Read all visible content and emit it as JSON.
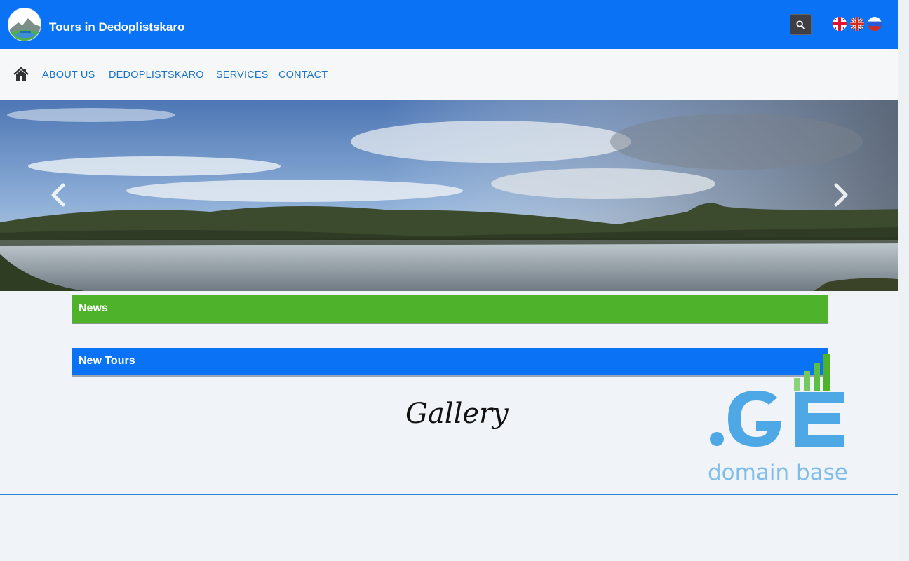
{
  "header": {
    "site_title": "Tours in Dedoplistskaro",
    "logo_icon": "mountain-logo-icon",
    "search_icon": "search-icon",
    "languages": [
      {
        "code": "ka",
        "icon": "georgia-flag-icon"
      },
      {
        "code": "en",
        "icon": "uk-flag-icon"
      },
      {
        "code": "ru",
        "icon": "russia-flag-icon"
      }
    ]
  },
  "nav": {
    "home_icon": "home-icon",
    "items": [
      {
        "label": "ABOUT US"
      },
      {
        "label": "DEDOPLISTSKARO"
      },
      {
        "label": "SERVICES"
      },
      {
        "label": "CONTACT"
      }
    ]
  },
  "hero": {
    "prev_icon": "chevron-left-icon",
    "next_icon": "chevron-right-icon"
  },
  "sections": {
    "news": "News",
    "new_tours": "New Tours",
    "gallery": "Gallery"
  },
  "badge": {
    "brand": ".GE",
    "text": "domain base"
  },
  "colors": {
    "header_blue": "#0a73f5",
    "news_green": "#4eb22a",
    "nav_link": "#1a73c9"
  }
}
